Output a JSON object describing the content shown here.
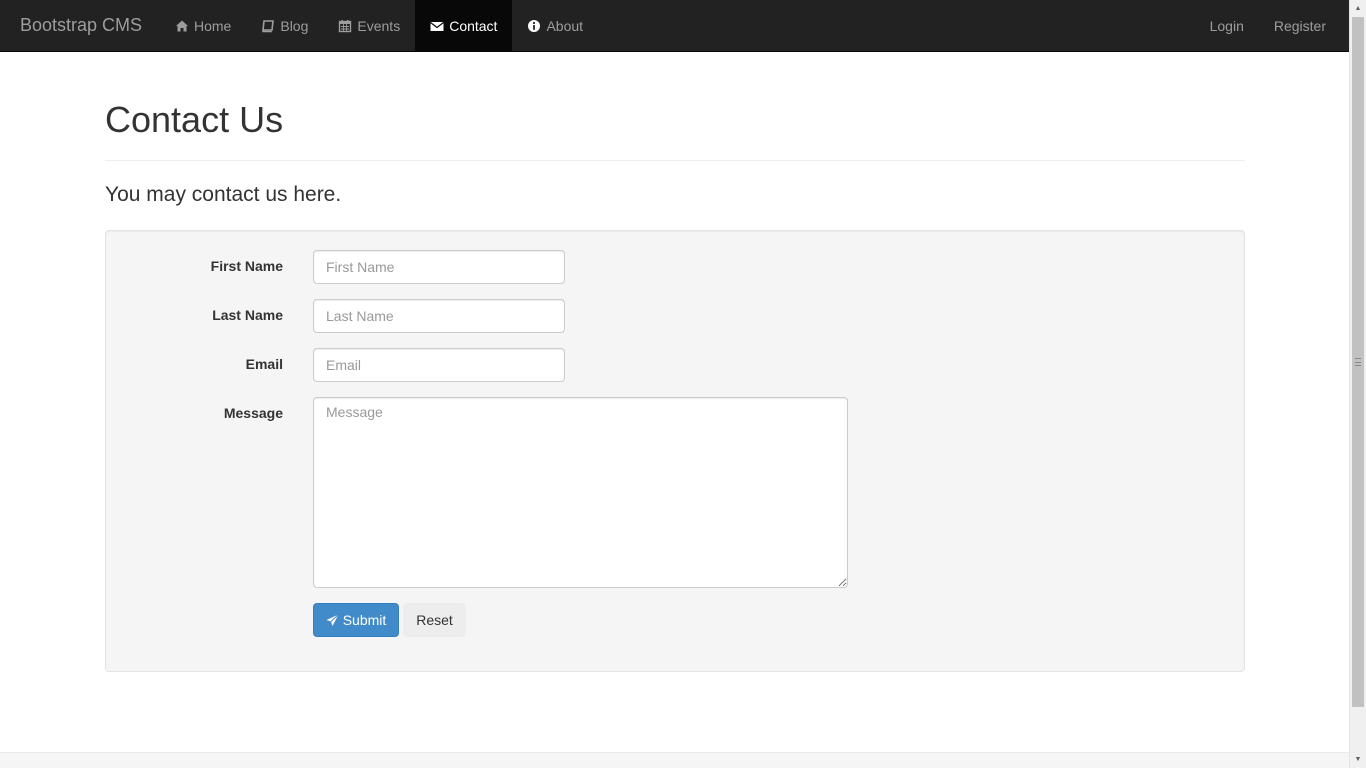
{
  "navbar": {
    "brand": "Bootstrap CMS",
    "items": [
      {
        "label": "Home",
        "icon": "home-icon",
        "active": false
      },
      {
        "label": "Blog",
        "icon": "book-icon",
        "active": false
      },
      {
        "label": "Events",
        "icon": "calendar-icon",
        "active": false
      },
      {
        "label": "Contact",
        "icon": "envelope-icon",
        "active": true
      },
      {
        "label": "About",
        "icon": "info-icon",
        "active": false
      }
    ],
    "right": [
      {
        "label": "Login"
      },
      {
        "label": "Register"
      }
    ]
  },
  "page": {
    "title": "Contact Us",
    "lead": "You may contact us here."
  },
  "form": {
    "first_name": {
      "label": "First Name",
      "placeholder": "First Name",
      "value": ""
    },
    "last_name": {
      "label": "Last Name",
      "placeholder": "Last Name",
      "value": ""
    },
    "email": {
      "label": "Email",
      "placeholder": "Email",
      "value": ""
    },
    "message": {
      "label": "Message",
      "placeholder": "Message",
      "value": ""
    },
    "submit_label": "Submit",
    "submit_icon": "rocket-icon",
    "reset_label": "Reset"
  },
  "colors": {
    "navbar_bg": "#222222",
    "navbar_active_bg": "#080808",
    "primary": "#428bca",
    "well_bg": "#f5f5f5"
  }
}
